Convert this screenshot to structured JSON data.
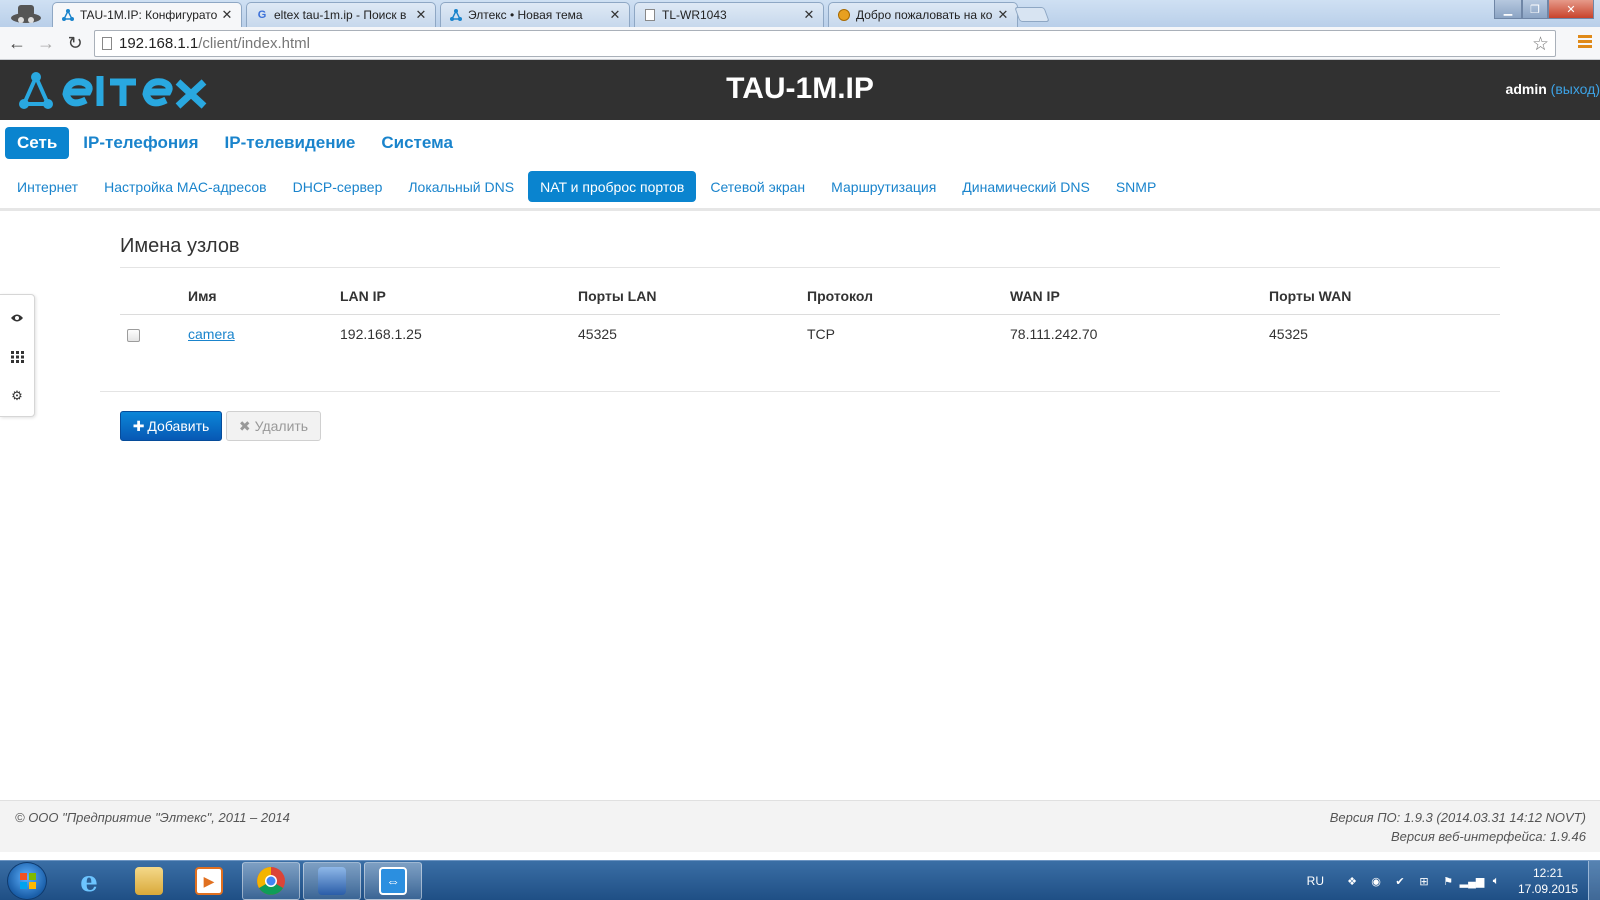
{
  "browser": {
    "tabs": [
      {
        "title": "TAU-1M.IP: Конфигурато",
        "active": true
      },
      {
        "title": "eltex tau-1m.ip - Поиск в",
        "active": false
      },
      {
        "title": "Элтекс • Новая тема",
        "active": false
      },
      {
        "title": "TL-WR1043",
        "active": false
      },
      {
        "title": "Добро пожаловать на ко",
        "active": false
      }
    ],
    "url_host": "192.168.1.1",
    "url_path": "/client/index.html"
  },
  "header": {
    "product": "TAU-1M.IP",
    "user": "admin",
    "logout": "(выход)"
  },
  "main_menu": [
    {
      "label": "Сеть",
      "active": true
    },
    {
      "label": "IP-телефония",
      "active": false
    },
    {
      "label": "IP-телевидение",
      "active": false
    },
    {
      "label": "Система",
      "active": false
    }
  ],
  "sub_menu": [
    {
      "label": "Интернет",
      "active": false
    },
    {
      "label": "Настройка MAC-адресов",
      "active": false
    },
    {
      "label": "DHCP-сервер",
      "active": false
    },
    {
      "label": "Локальный DNS",
      "active": false
    },
    {
      "label": "NAT и проброс портов",
      "active": true
    },
    {
      "label": "Сетевой экран",
      "active": false
    },
    {
      "label": "Маршрутизация",
      "active": false
    },
    {
      "label": "Динамический DNS",
      "active": false
    },
    {
      "label": "SNMP",
      "active": false
    }
  ],
  "sidebar_icons": [
    "eye-icon",
    "grid-icon",
    "gear-icon"
  ],
  "content": {
    "title": "Имена узлов",
    "columns": [
      "Имя",
      "LAN IP",
      "Порты LAN",
      "Протокол",
      "WAN IP",
      "Порты WAN"
    ],
    "rows": [
      {
        "checked": false,
        "name": "camera",
        "lan_ip": "192.168.1.25",
        "lan_ports": "45325",
        "protocol": "TCP",
        "wan_ip": "78.111.242.70",
        "wan_ports": "45325"
      }
    ],
    "add_button": "Добавить",
    "delete_button": "Удалить"
  },
  "footer": {
    "copyright": "© ООО \"Предприятие \"Элтекс\", 2011 – 2014",
    "fw_version": "Версия ПО: 1.9.3 (2014.03.31 14:12 NOVT)",
    "web_version": "Версия веб-интерфейса: 1.9.46"
  },
  "taskbar": {
    "lang": "RU",
    "time": "12:21",
    "date": "17.09.2015"
  },
  "colors": {
    "accent": "#0a84cf",
    "link": "#1a84cc",
    "header_bg": "#313131"
  }
}
